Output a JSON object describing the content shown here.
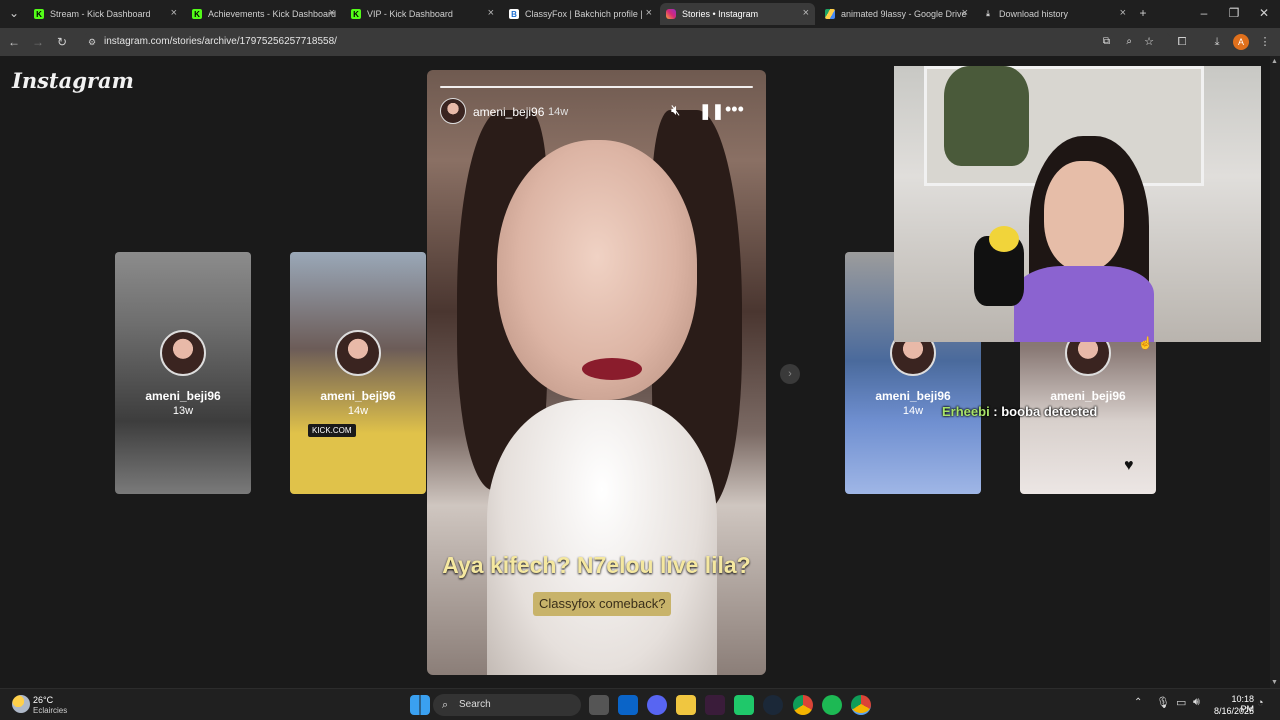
{
  "browser": {
    "tabs": [
      {
        "title": "Stream - Kick Dashboard",
        "favicon": "kick-icon",
        "active": false
      },
      {
        "title": "Achievements - Kick Dashboard",
        "favicon": "kick-icon",
        "active": false
      },
      {
        "title": "VIP - Kick Dashboard",
        "favicon": "kick-icon",
        "active": false
      },
      {
        "title": "ClassyFox | Bakchich profile | B...",
        "favicon": "bakchich-icon",
        "active": false
      },
      {
        "title": "Stories • Instagram",
        "favicon": "instagram-icon",
        "active": true
      },
      {
        "title": "animated 9lassy - Google Drive",
        "favicon": "drive-icon",
        "active": false
      },
      {
        "title": "Download history",
        "favicon": "download-icon",
        "active": false
      }
    ],
    "new_tab_symbol": "+",
    "url": "instagram.com/stories/archive/17975256257718558/",
    "profile_initial": "A"
  },
  "instagram": {
    "logo_text": "Instagram",
    "main_story": {
      "username": "ameni_beji96",
      "age": "14w",
      "caption_line1": "Aya kifech? N7elou live lila?",
      "caption_line2": "Classyfox comeback?"
    },
    "side_stories": [
      {
        "username": "ameni_beji96",
        "age": "13w"
      },
      {
        "username": "ameni_beji96",
        "age": "14w",
        "sticker": "KICK.COM"
      },
      {
        "username": "ameni_beji96",
        "age": "14w"
      },
      {
        "username": "ameni_beji96",
        "age": ""
      }
    ]
  },
  "stream_overlay": {
    "chat_user": "Erheebi",
    "chat_message": " : booba detected"
  },
  "taskbar": {
    "weather_temp": "26°C",
    "weather_desc": "Eclaircies",
    "search_placeholder": "Search",
    "time": "10:18 PM",
    "date": "8/16/2025"
  },
  "colors": {
    "kick_green": "#53fc18",
    "instagram_bg": "#1a1a1a",
    "caption_yellow": "#f5e8a0",
    "chat_name_green": "#a8e36a"
  }
}
